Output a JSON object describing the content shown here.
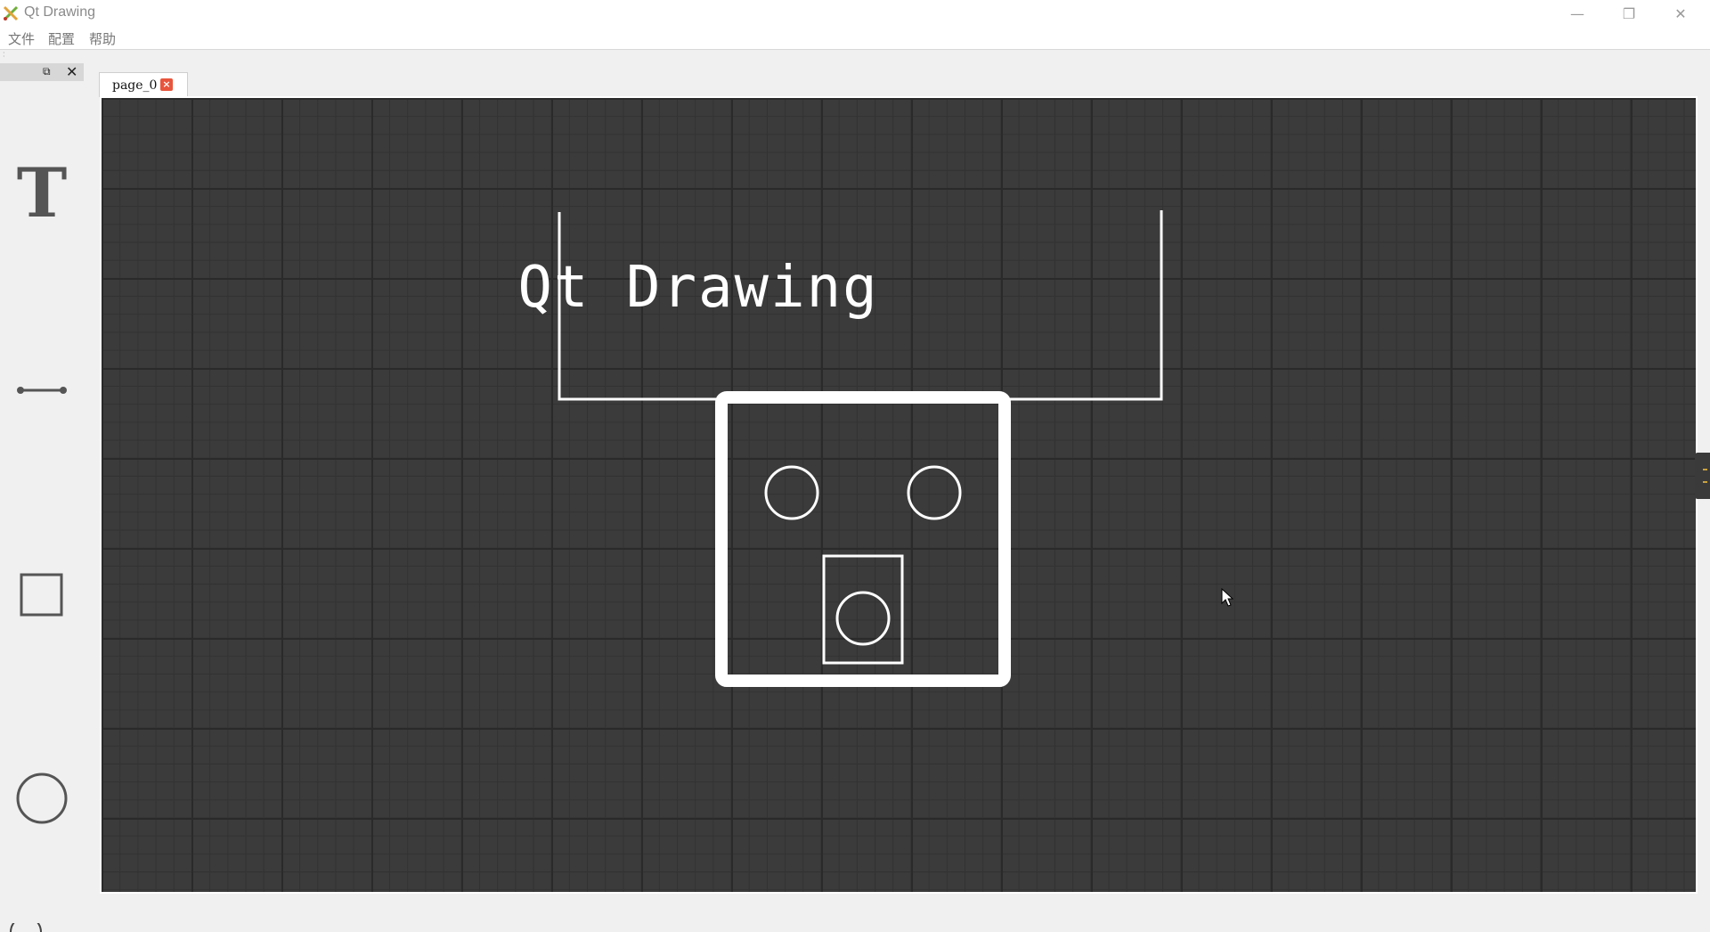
{
  "window": {
    "title": "Qt Drawing",
    "minimize_symbol": "—",
    "restore_symbol": "❐",
    "close_symbol": "✕"
  },
  "menu": {
    "items": [
      "文件",
      "配置",
      "帮助"
    ]
  },
  "dock": {
    "float_symbol": "⧉",
    "close_symbol": "✕",
    "tools": [
      {
        "name": "text-tool",
        "glyph": "T"
      },
      {
        "name": "line-tool",
        "icon": "line-icon"
      },
      {
        "name": "rect-tool",
        "icon": "rectangle-icon"
      },
      {
        "name": "ellipse-tool",
        "icon": "circle-icon"
      }
    ]
  },
  "tabs": [
    {
      "label": "page_0",
      "close_symbol": "×"
    }
  ],
  "canvas": {
    "background": "#3b3b3b",
    "title_text": "Qt Drawing",
    "shape_color": "#ffffff"
  }
}
